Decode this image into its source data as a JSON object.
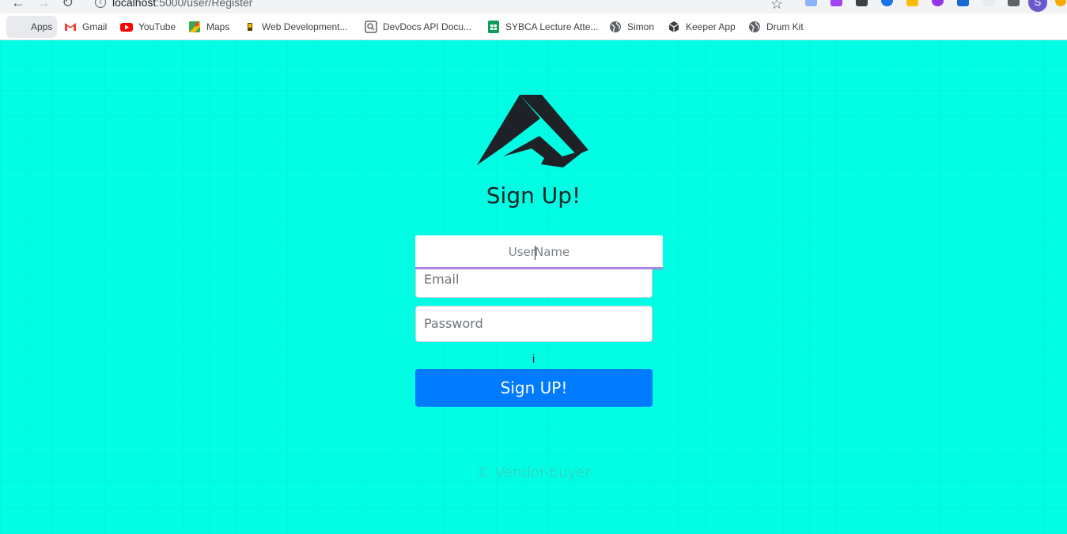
{
  "browser": {
    "url_host": "localhost",
    "url_rest": ":5000/user/Register",
    "profile_initial": "S"
  },
  "bookmarks": {
    "apps": "Apps",
    "items": [
      {
        "label": "Gmail",
        "icon": "gmail-icon"
      },
      {
        "label": "YouTube",
        "icon": "youtube-icon"
      },
      {
        "label": "Maps",
        "icon": "maps-icon"
      },
      {
        "label": "Web Development...",
        "icon": "bookmark-icon"
      },
      {
        "label": "DevDocs API Docu...",
        "icon": "devdocs-icon"
      },
      {
        "label": "SYBCA Lecture Atte...",
        "icon": "sheets-icon"
      },
      {
        "label": "Simon",
        "icon": "globe-icon"
      },
      {
        "label": "Keeper App",
        "icon": "cube-icon"
      },
      {
        "label": "Drum Kit",
        "icon": "globe-icon"
      }
    ]
  },
  "page": {
    "title": "Sign Up!",
    "username_placeholder_a": "User",
    "username_placeholder_b": "Name",
    "email_placeholder": "Email",
    "password_placeholder": "Password",
    "stray_text": "i",
    "submit_label": "Sign UP!",
    "footer": "© Vendor-buyer"
  },
  "colors": {
    "background": "#00fde4",
    "button": "#007bff",
    "username_underline": "#b185e6"
  }
}
